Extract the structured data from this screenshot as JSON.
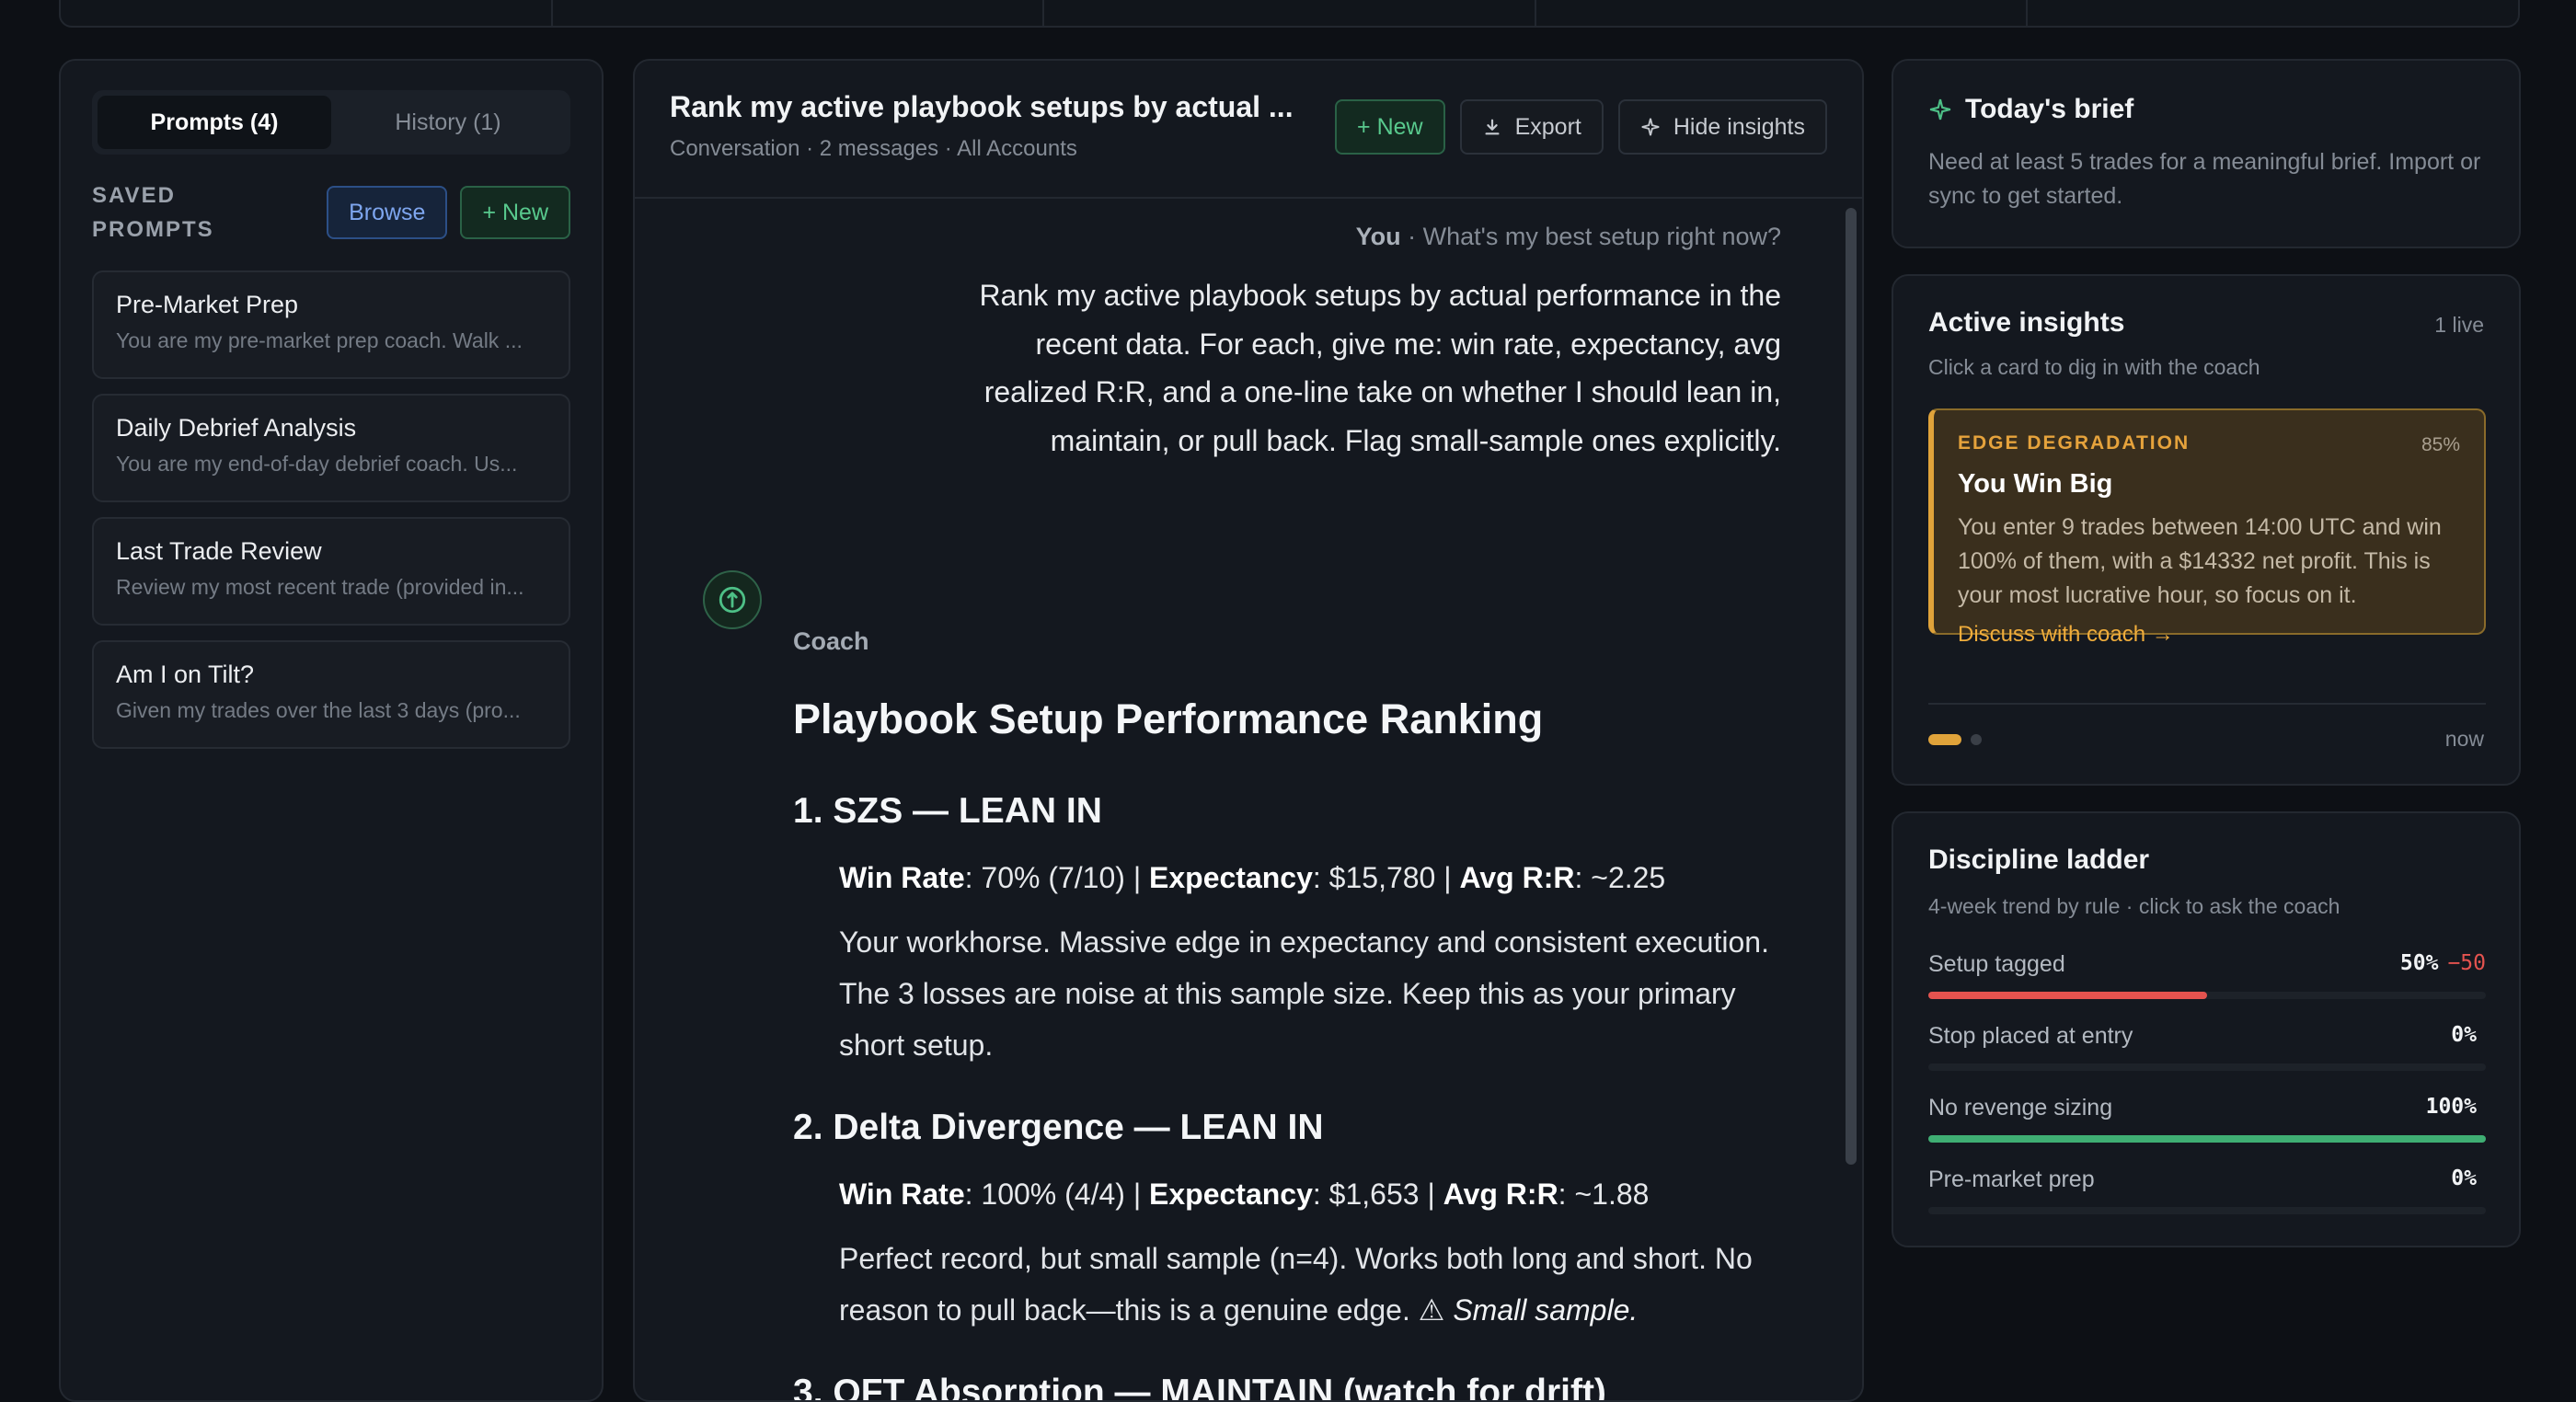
{
  "left": {
    "tabs": [
      {
        "label": "Prompts (4)",
        "active": true
      },
      {
        "label": "History (1)",
        "active": false
      }
    ],
    "saved_label": "SAVED PROMPTS",
    "browse_label": "Browse",
    "new_label": "+ New",
    "prompts": [
      {
        "title": "Pre-Market Prep",
        "desc": "You are my pre-market prep coach. Walk ..."
      },
      {
        "title": "Daily Debrief Analysis",
        "desc": "You are my end-of-day debrief coach. Us..."
      },
      {
        "title": "Last Trade Review",
        "desc": "Review my most recent trade (provided in..."
      },
      {
        "title": "Am I on Tilt?",
        "desc": "Given my trades over the last 3 days (pro..."
      }
    ]
  },
  "chat": {
    "title": "Rank my active playbook setups by actual ...",
    "subtitle": "Conversation · 2 messages · All Accounts",
    "new_label": "+ New",
    "export_label": "Export",
    "hide_label": "Hide insights",
    "user_name": "You",
    "user_context": "· What's my best setup right now?",
    "user_message": "Rank my active playbook setups by actual performance in the recent data. For each, give me: win rate, expectancy, avg realized R:R, and a one-line take on whether I should lean in, maintain, or pull back. Flag small-sample ones explicitly.",
    "coach_name": "Coach",
    "response": {
      "heading": "Playbook Setup Performance Ranking",
      "setups": [
        {
          "heading": "1. SZS — LEAN IN",
          "wr_label": "Win Rate",
          "wr_value": ": 70% (7/10) |",
          "exp_label": "Expectancy",
          "exp_value": ": $15,780 |",
          "rr_label": "Avg R:R",
          "rr_value": ": ~2.25",
          "body": "Your workhorse. Massive edge in expectancy and consistent execution. The 3 losses are noise at this sample size. Keep this as your primary short setup.",
          "flag": ""
        },
        {
          "heading": "2. Delta Divergence — LEAN IN",
          "wr_label": "Win Rate",
          "wr_value": ": 100% (4/4) |",
          "exp_label": "Expectancy",
          "exp_value": ": $1,653 |",
          "rr_label": "Avg R:R",
          "rr_value": ": ~1.88",
          "body": "Perfect record, but small sample (n=4). Works both long and short. No reason to pull back—this is a genuine edge. ⚠",
          "flag": "Small sample."
        },
        {
          "heading": "3. OFT Absorption — MAINTAIN (watch for drift)"
        }
      ]
    }
  },
  "brief": {
    "title": "Today's brief",
    "text": "Need at least 5 trades for a meaningful brief. Import or sync to get started."
  },
  "insights": {
    "title": "Active insights",
    "count": "1 live",
    "subtitle": "Click a card to dig in with the coach",
    "card": {
      "tag": "EDGE DEGRADATION",
      "confidence": "85%",
      "title": "You Win Big",
      "text": "You enter 9 trades between 14:00 UTC and win 100% of them, with a $14332 net profit. This is your most lucrative hour, so focus on it.",
      "link": "Discuss with coach →"
    },
    "time": "now"
  },
  "ladder": {
    "title": "Discipline ladder",
    "subtitle": "4-week trend by rule · click to ask the coach",
    "rules": [
      {
        "name": "Setup tagged",
        "value": "50%",
        "delta": "−50",
        "pct": 50,
        "color": "#e4534f"
      },
      {
        "name": "Stop placed at entry",
        "value": "0%",
        "delta": "",
        "pct": 0,
        "color": "#e4534f"
      },
      {
        "name": "No revenge sizing",
        "value": "100%",
        "delta": "",
        "pct": 100,
        "color": "#3fae73"
      },
      {
        "name": "Pre-market prep",
        "value": "0%",
        "delta": "",
        "pct": 0,
        "color": "#e4534f"
      }
    ]
  }
}
